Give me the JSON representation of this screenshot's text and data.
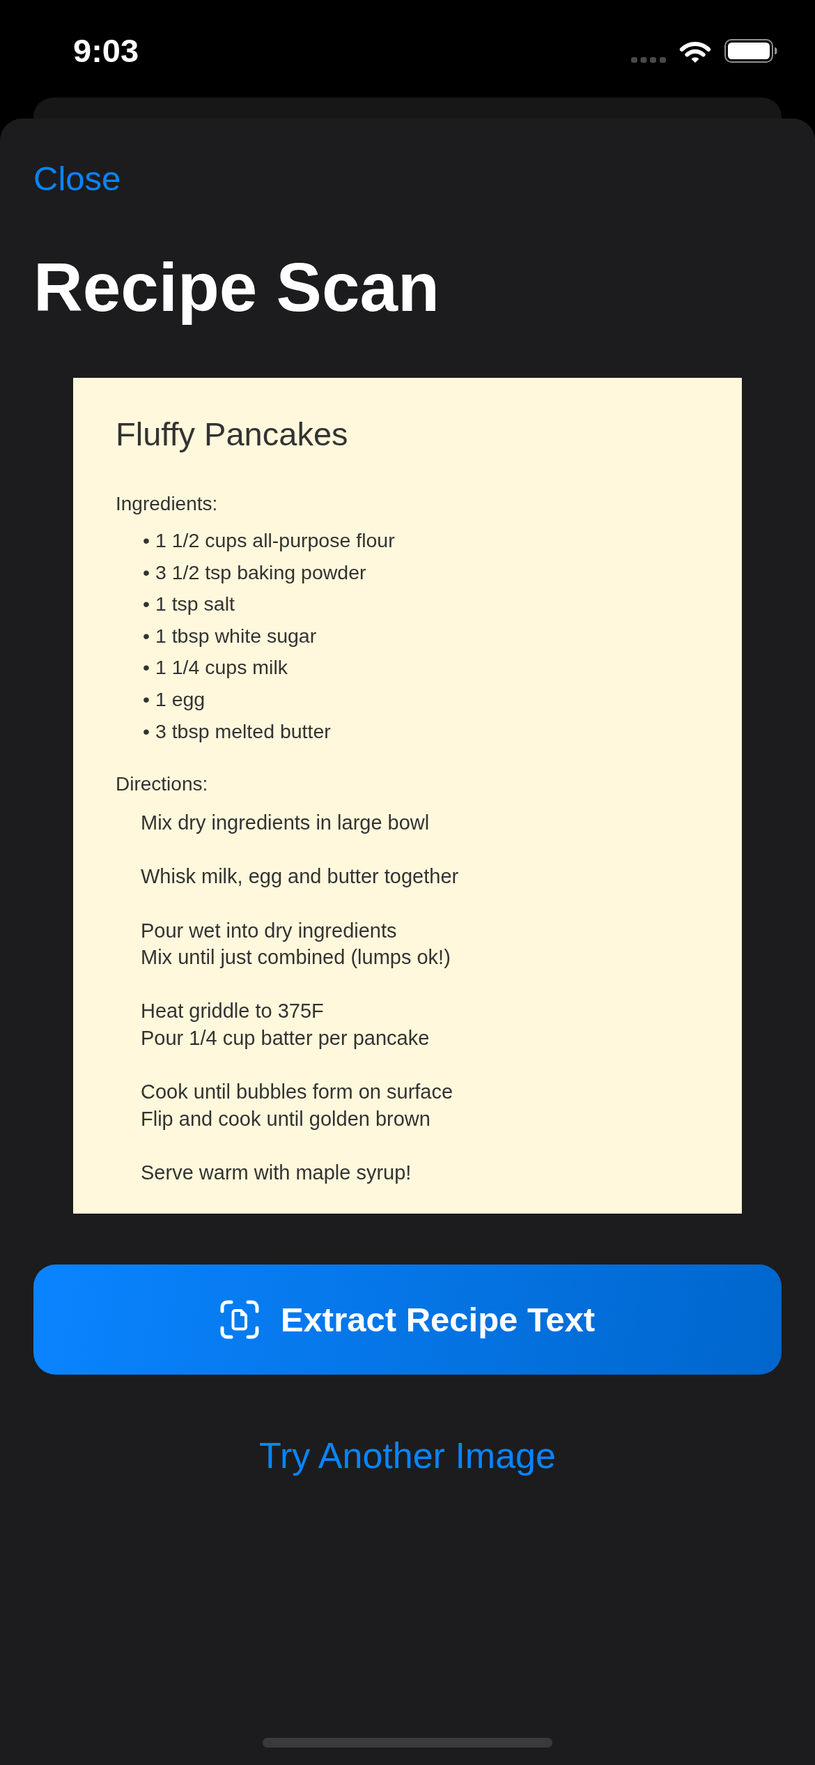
{
  "status_bar": {
    "time": "9:03"
  },
  "sheet": {
    "close_label": "Close",
    "title": "Recipe Scan"
  },
  "recipe_image": {
    "title": "Fluffy Pancakes",
    "ingredients_heading": "Ingredients:",
    "ingredients": [
      "• 1 1/2 cups all-purpose flour",
      "• 3 1/2 tsp baking powder",
      "• 1 tsp salt",
      "• 1 tbsp white sugar",
      "• 1 1/4 cups milk",
      "• 1 egg",
      "• 3 tbsp melted butter"
    ],
    "directions_heading": "Directions:",
    "directions": [
      [
        "Mix dry ingredients in large bowl"
      ],
      [
        "Whisk milk, egg and butter together"
      ],
      [
        "Pour wet into dry ingredients",
        "Mix until just combined (lumps ok!)"
      ],
      [
        "Heat griddle to 375F",
        "Pour 1/4 cup batter per pancake"
      ],
      [
        "Cook until bubbles form on surface",
        "Flip and cook until golden brown"
      ],
      [
        "Serve warm with maple syrup!"
      ]
    ]
  },
  "primary_button": {
    "label": "Extract Recipe Text"
  },
  "secondary_button": {
    "label": "Try Another Image"
  }
}
